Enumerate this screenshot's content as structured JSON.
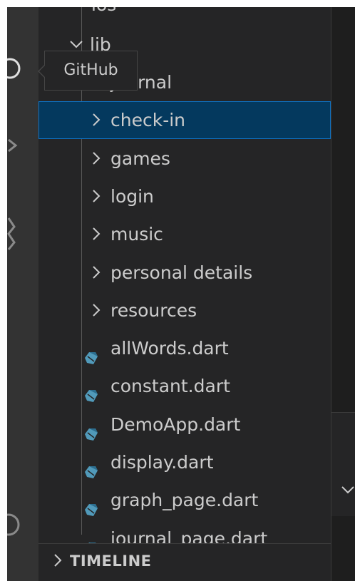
{
  "explorer": {
    "partial_top": "ios",
    "lib": "lib",
    "tooltip": "GitHub",
    "items": [
      {
        "type": "folder",
        "label": "journal"
      },
      {
        "type": "folder",
        "label": "check-in",
        "selected": true
      },
      {
        "type": "folder",
        "label": "games"
      },
      {
        "type": "folder",
        "label": "login"
      },
      {
        "type": "folder",
        "label": "music"
      },
      {
        "type": "folder",
        "label": "personal details"
      },
      {
        "type": "folder",
        "label": "resources"
      },
      {
        "type": "file",
        "label": "allWords.dart"
      },
      {
        "type": "file",
        "label": "constant.dart"
      },
      {
        "type": "file",
        "label": "DemoApp.dart"
      },
      {
        "type": "file",
        "label": "display.dart"
      },
      {
        "type": "file",
        "label": "graph_page.dart"
      },
      {
        "type": "file",
        "label": "journal_page.dart"
      }
    ]
  },
  "timeline": {
    "label": "TIMELINE"
  },
  "colors": {
    "selection_bg": "#04395e",
    "selection_border": "#0e70c0",
    "dart_icon": "#519aba"
  }
}
